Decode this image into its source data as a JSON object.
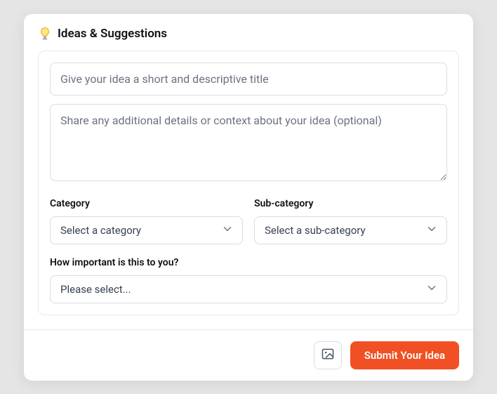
{
  "header": {
    "title": "Ideas & Suggestions"
  },
  "form": {
    "title_placeholder": "Give your idea a short and descriptive title",
    "details_placeholder": "Share any additional details or context about your idea (optional)",
    "category_label": "Category",
    "category_value": "Select a category",
    "subcategory_label": "Sub-category",
    "subcategory_value": "Select a sub-category",
    "importance_label": "How important is this to you?",
    "importance_value": "Please select..."
  },
  "footer": {
    "submit_label": "Submit Your Idea"
  }
}
